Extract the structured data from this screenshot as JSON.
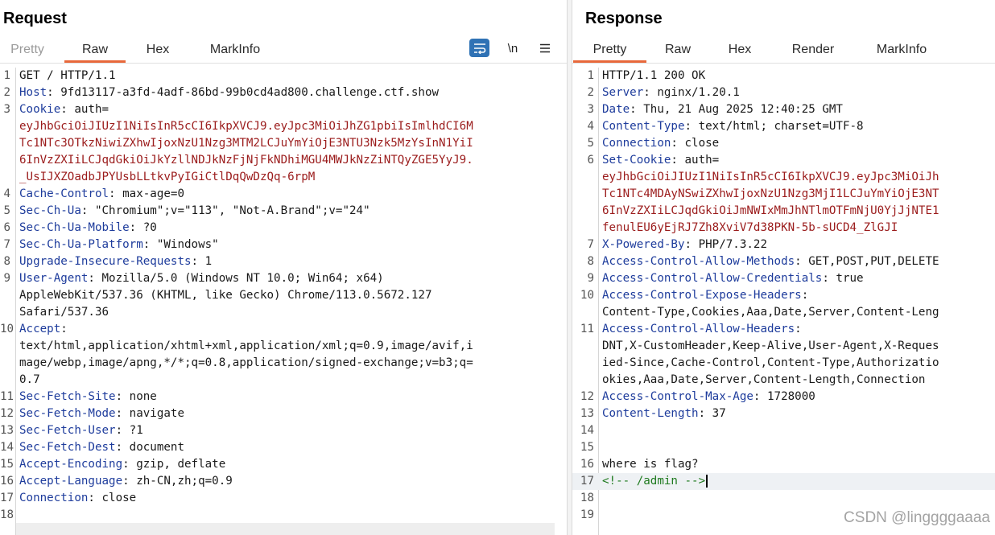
{
  "request": {
    "title": "Request",
    "tabs": [
      "Pretty",
      "Raw",
      "Hex",
      "MarkInfo"
    ],
    "active_tab": "Raw",
    "toolbar": {
      "wrap_icon": "wrap-lines-icon",
      "newline_label": "\\n",
      "menu_icon": "hamburger-menu-icon"
    },
    "lines": [
      {
        "n": "1",
        "text": "GET / HTTP/1.1"
      },
      {
        "n": "2",
        "key": "Host",
        "value": " 9fd13117-a3fd-4adf-86bd-99b0cd4ad800.challenge.ctf.show"
      },
      {
        "n": "3",
        "key": "Cookie",
        "value": " auth="
      },
      {
        "n": "",
        "red": "eyJhbGciOiJIUzI1NiIsInR5cCI6IkpXVCJ9.eyJpc3MiOiJhZG1pbiIsImlhdCI6M"
      },
      {
        "n": "",
        "red": "Tc1NTc3OTkzNiwiZXhwIjoxNzU1Nzg3MTM2LCJuYmYiOjE3NTU3Nzk5MzYsInN1YiI"
      },
      {
        "n": "",
        "red": "6InVzZXIiLCJqdGkiOiJkYzllNDJkNzFjNjFkNDhiMGU4MWJkNzZiNTQyZGE5YyJ9."
      },
      {
        "n": "",
        "red": "_UsIJXZOadbJPYUsbLLtkvPyIGiCtlDqQwDzQq-6rpM"
      },
      {
        "n": "4",
        "key": "Cache-Control",
        "value": " max-age=0"
      },
      {
        "n": "5",
        "key": "Sec-Ch-Ua",
        "value": " \"Chromium\";v=\"113\", \"Not-A.Brand\";v=\"24\""
      },
      {
        "n": "6",
        "key": "Sec-Ch-Ua-Mobile",
        "value": " ?0"
      },
      {
        "n": "7",
        "key": "Sec-Ch-Ua-Platform",
        "value": " \"Windows\""
      },
      {
        "n": "8",
        "key": "Upgrade-Insecure-Requests",
        "value": " 1"
      },
      {
        "n": "9",
        "key": "User-Agent",
        "value": " Mozilla/5.0 (Windows NT 10.0; Win64; x64)"
      },
      {
        "n": "",
        "text": "AppleWebKit/537.36 (KHTML, like Gecko) Chrome/113.0.5672.127"
      },
      {
        "n": "",
        "text": "Safari/537.36"
      },
      {
        "n": "10",
        "key": "Accept",
        "value": ""
      },
      {
        "n": "",
        "text": "text/html,application/xhtml+xml,application/xml;q=0.9,image/avif,i"
      },
      {
        "n": "",
        "text": "mage/webp,image/apng,*/*;q=0.8,application/signed-exchange;v=b3;q="
      },
      {
        "n": "",
        "text": "0.7"
      },
      {
        "n": "11",
        "key": "Sec-Fetch-Site",
        "value": " none"
      },
      {
        "n": "12",
        "key": "Sec-Fetch-Mode",
        "value": " navigate"
      },
      {
        "n": "13",
        "key": "Sec-Fetch-User",
        "value": " ?1"
      },
      {
        "n": "14",
        "key": "Sec-Fetch-Dest",
        "value": " document"
      },
      {
        "n": "15",
        "key": "Accept-Encoding",
        "value": " gzip, deflate"
      },
      {
        "n": "16",
        "key": "Accept-Language",
        "value": " zh-CN,zh;q=0.9"
      },
      {
        "n": "17",
        "key": "Connection",
        "value": " close"
      },
      {
        "n": "18",
        "text": ""
      }
    ]
  },
  "response": {
    "title": "Response",
    "tabs": [
      "Pretty",
      "Raw",
      "Hex",
      "Render",
      "MarkInfo"
    ],
    "active_tab": "Pretty",
    "lines": [
      {
        "n": "1",
        "text": "HTTP/1.1 200 OK"
      },
      {
        "n": "2",
        "key": "Server",
        "value": " nginx/1.20.1"
      },
      {
        "n": "3",
        "key": "Date",
        "value": " Thu, 21 Aug 2025 12:40:25 GMT"
      },
      {
        "n": "4",
        "key": "Content-Type",
        "value": " text/html; charset=UTF-8"
      },
      {
        "n": "5",
        "key": "Connection",
        "value": " close"
      },
      {
        "n": "6",
        "key": "Set-Cookie",
        "value": " auth="
      },
      {
        "n": "",
        "red": "eyJhbGciOiJIUzI1NiIsInR5cCI6IkpXVCJ9.eyJpc3MiOiJh"
      },
      {
        "n": "",
        "red": "Tc1NTc4MDAyNSwiZXhwIjoxNzU1Nzg3MjI1LCJuYmYiOjE3NT"
      },
      {
        "n": "",
        "red": "6InVzZXIiLCJqdGkiOiJmNWIxMmJhNTlmOTFmNjU0YjJjNTE1"
      },
      {
        "n": "",
        "red": "fenulEU6yEjRJ7Zh8XviV7d38PKN-5b-sUCD4_ZlGJI"
      },
      {
        "n": "7",
        "key": "X-Powered-By",
        "value": " PHP/7.3.22"
      },
      {
        "n": "8",
        "key": "Access-Control-Allow-Methods",
        "value": " GET,POST,PUT,DELETE"
      },
      {
        "n": "9",
        "key": "Access-Control-Allow-Credentials",
        "value": " true"
      },
      {
        "n": "10",
        "key": "Access-Control-Expose-Headers",
        "value": ""
      },
      {
        "n": "",
        "text": "Content-Type,Cookies,Aaa,Date,Server,Content-Leng"
      },
      {
        "n": "11",
        "key": "Access-Control-Allow-Headers",
        "value": ""
      },
      {
        "n": "",
        "text": "DNT,X-CustomHeader,Keep-Alive,User-Agent,X-Reques"
      },
      {
        "n": "",
        "text": "ied-Since,Cache-Control,Content-Type,Authorizatio"
      },
      {
        "n": "",
        "text": "okies,Aaa,Date,Server,Content-Length,Connection"
      },
      {
        "n": "12",
        "key": "Access-Control-Max-Age",
        "value": " 1728000"
      },
      {
        "n": "13",
        "key": "Content-Length",
        "value": " 37"
      },
      {
        "n": "14",
        "text": ""
      },
      {
        "n": "15",
        "text": ""
      },
      {
        "n": "16",
        "text": "where is flag?"
      },
      {
        "n": "17",
        "green": "<!-- /admin -->",
        "current": true
      },
      {
        "n": "18",
        "text": ""
      },
      {
        "n": "19",
        "text": ""
      }
    ]
  },
  "watermark": "CSDN @linggggaaaa"
}
